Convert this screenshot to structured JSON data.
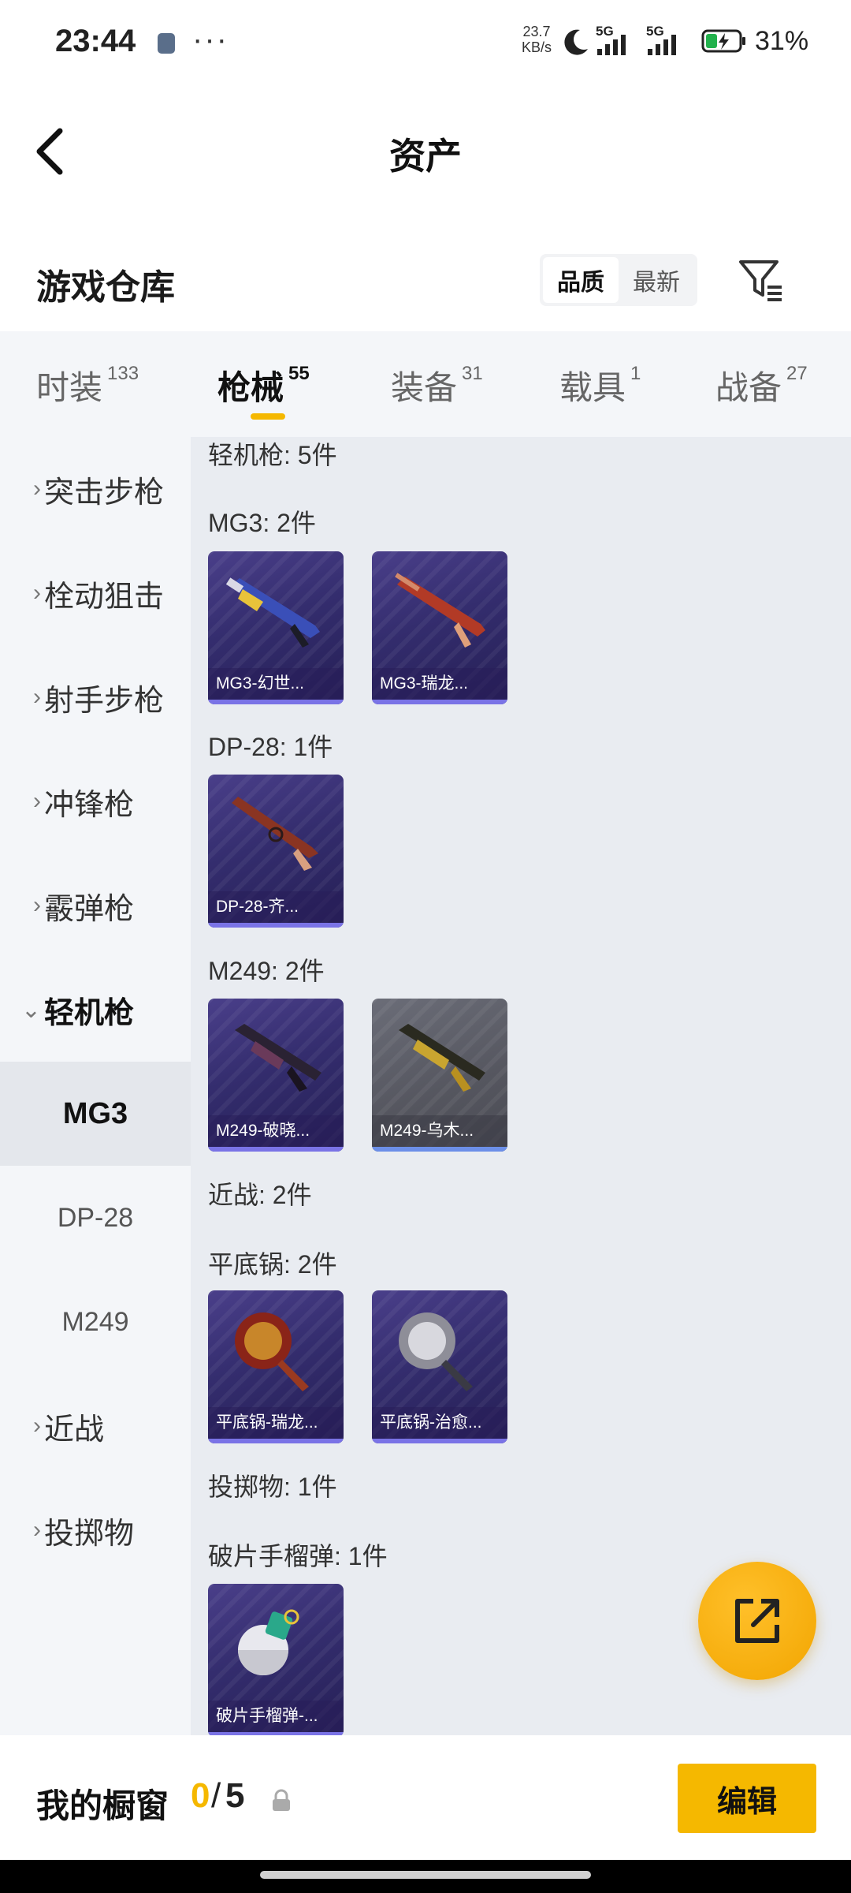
{
  "status_bar": {
    "time": "23:44",
    "dots": "···",
    "speed_value": "23.7",
    "speed_unit": "KB/s",
    "net1": "5G",
    "net2": "5G",
    "battery": "31%"
  },
  "header": {
    "title": "资产"
  },
  "warehouse": {
    "title": "游戏仓库",
    "sort_options": [
      {
        "label": "品质",
        "active": true
      },
      {
        "label": "最新",
        "active": false
      }
    ]
  },
  "tabs": [
    {
      "label": "时装",
      "count": "133"
    },
    {
      "label": "枪械",
      "count": "55",
      "active": true
    },
    {
      "label": "装备",
      "count": "31"
    },
    {
      "label": "载具",
      "count": "1"
    },
    {
      "label": "战备",
      "count": "27"
    }
  ],
  "sidebar": {
    "categories": [
      {
        "label": "突击步枪"
      },
      {
        "label": "栓动狙击"
      },
      {
        "label": "射手步枪"
      },
      {
        "label": "冲锋枪"
      },
      {
        "label": "霰弹枪"
      },
      {
        "label": "轻机枪",
        "expanded": true
      },
      {
        "label": "近战"
      },
      {
        "label": "投掷物"
      }
    ],
    "subitems": [
      {
        "label": "MG3",
        "active": true
      },
      {
        "label": "DP-28"
      },
      {
        "label": "M249"
      }
    ]
  },
  "content": {
    "sections": [
      "轻机枪: 5件",
      "MG3: 2件",
      "DP-28: 1件",
      "M249: 2件",
      "近战: 2件",
      "平底锅: 2件",
      "投掷物: 1件",
      "破片手榴弹: 1件"
    ],
    "items": [
      {
        "label": "MG3-幻世...",
        "icon": "lmg-blue-skin-icon"
      },
      {
        "label": "MG3-瑞龙...",
        "icon": "lmg-red-skin-icon"
      },
      {
        "label": "DP-28-齐...",
        "icon": "dp28-skin-icon"
      },
      {
        "label": "M249-破晓...",
        "icon": "m249-dark-skin-icon"
      },
      {
        "label": "M249-乌木...",
        "icon": "m249-gold-skin-icon"
      },
      {
        "label": "平底锅-瑞龙...",
        "icon": "pan-gold-skin-icon"
      },
      {
        "label": "平底锅-治愈...",
        "icon": "pan-silver-skin-icon"
      },
      {
        "label": "破片手榴弹-...",
        "icon": "grenade-skin-icon"
      }
    ]
  },
  "bottom_bar": {
    "label": "我的橱窗",
    "count": "0",
    "slash": "/",
    "total": "5",
    "edit_label": "编辑"
  },
  "colors": {
    "accent": "#f5b800",
    "card": "#342d6e",
    "page_bg": "#e9ecf1"
  }
}
